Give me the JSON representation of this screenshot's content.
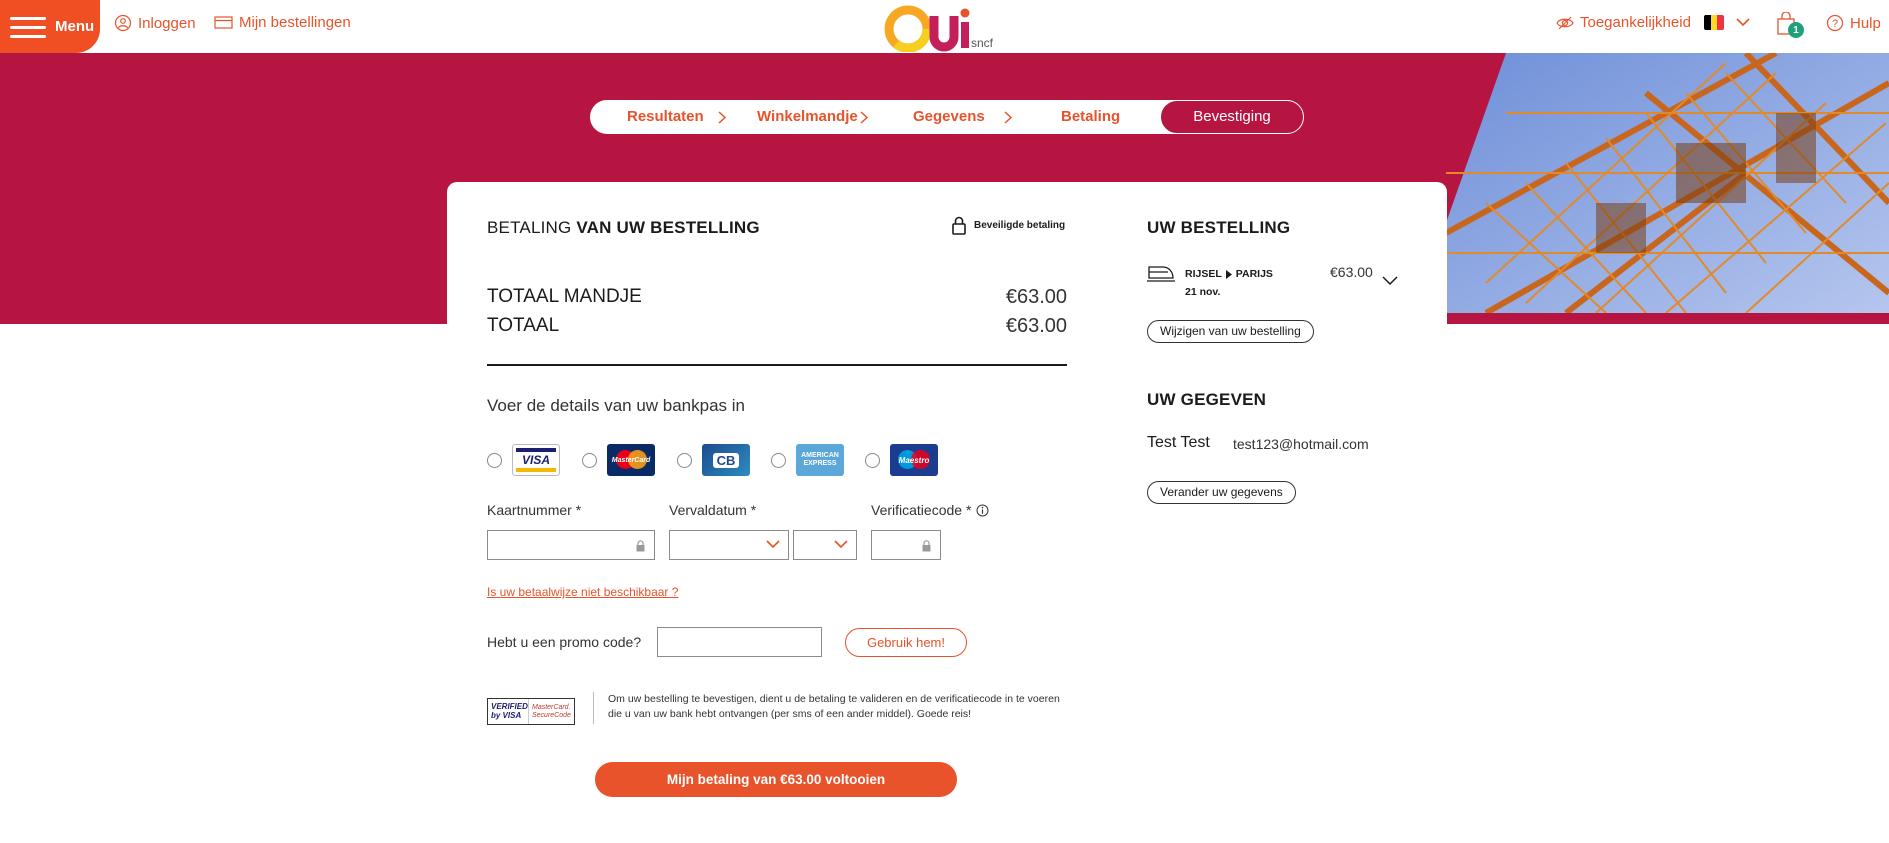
{
  "topbar": {
    "menu_label": "Menu",
    "login_label": "Inloggen",
    "orders_label": "Mijn bestellingen",
    "logo_text": "OUi.sncf",
    "accessibility_label": "Toegankelijkheid",
    "cart_count": "1",
    "help_label": "Hulp",
    "flag_colors": [
      "#000000",
      "#fdda24",
      "#ef3340"
    ]
  },
  "stepper": {
    "steps": [
      "Resultaten",
      "Winkelmandje",
      "Gegevens",
      "Betaling"
    ],
    "active": "Bevestiging"
  },
  "payment": {
    "title_prefix": "BETALING",
    "title_rest": "VAN UW BESTELLING",
    "secure_label": "Beveiligde betaling",
    "basket_total_label": "TOTAAL MANDJE",
    "basket_total_value": "€63.00",
    "total_label": "TOTAAL",
    "total_value": "€63.00",
    "card_prompt": "Voer de details van uw bankpas in",
    "card_types": [
      "VISA",
      "MasterCard",
      "CB",
      "AMERICAN EXPRESS",
      "Maestro"
    ],
    "card_number_label": "Kaartnummer *",
    "expiry_label": "Vervaldatum *",
    "cvc_label": "Verificatiecode *",
    "unavailable_link": "Is uw betaalwijze niet beschikbaar ?",
    "promo_label": "Hebt u een promo code?",
    "promo_button": "Gebruik hem!",
    "vbv_left": "VERIFIED by VISA",
    "vbv_right": "MasterCard. SecureCode",
    "note": "Om uw bestelling te bevestigen, dient u de betaling te valideren en de verificatiecode in te voeren die u van uw bank hebt ontvangen (per sms of een ander middel). Goede reis!",
    "confirm_button": "Mijn betaling van €63.00 voltooien"
  },
  "order": {
    "title": "UW BESTELLING",
    "from": "RIJSEL",
    "to": "PARIJS",
    "date": "21 nov.",
    "price": "€63.00",
    "modify_button": "Wijzigen van uw bestelling"
  },
  "details": {
    "title": "UW GEGEVEN",
    "name": "Test Test",
    "email": "test123@hotmail.com",
    "change_button": "Verander uw gegevens"
  },
  "colors": {
    "brand_orange": "#e8532c",
    "hero_red": "#b71541",
    "badge_green": "#1fa27a"
  }
}
